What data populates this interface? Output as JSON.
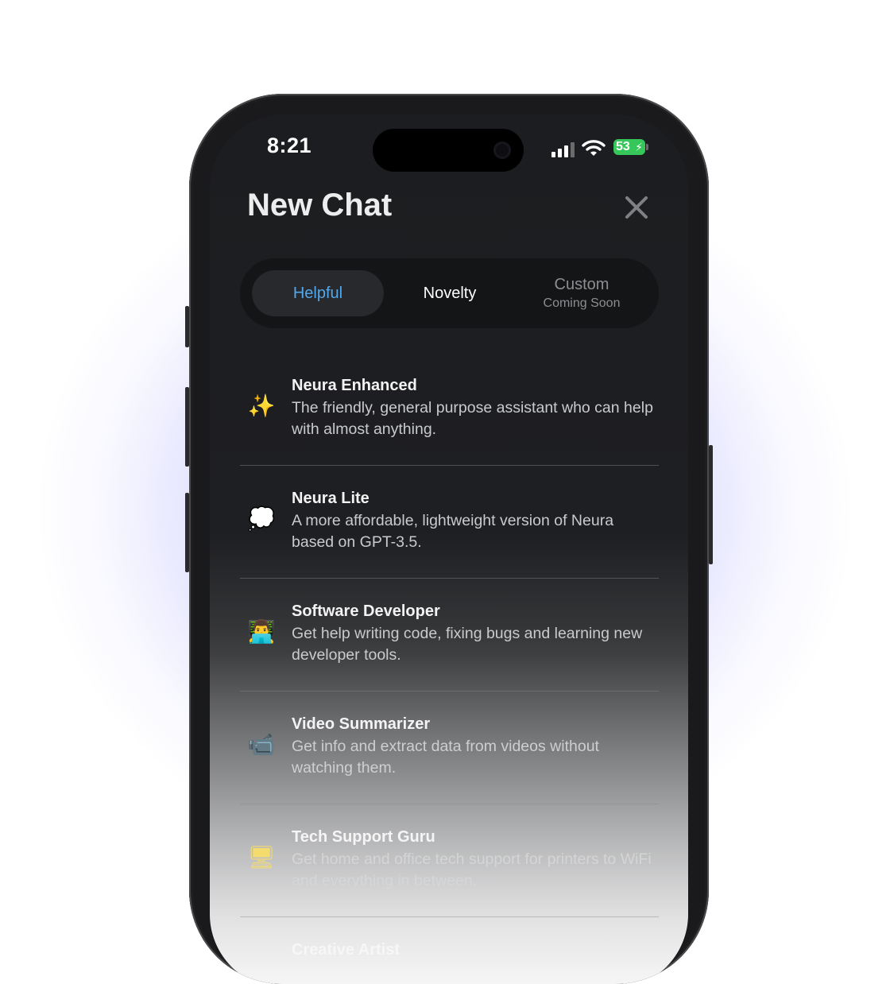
{
  "status_bar": {
    "time": "8:21",
    "battery": "53"
  },
  "header": {
    "title": "New Chat",
    "close_icon": "close-icon"
  },
  "tabs": [
    {
      "label": "Helpful",
      "active": true
    },
    {
      "label": "Novelty",
      "active": false
    },
    {
      "label": "Custom",
      "sublabel": "Coming Soon",
      "active": false
    }
  ],
  "assistants": [
    {
      "icon": "sparkles-icon",
      "glyph": "✨",
      "name": "Neura Enhanced",
      "description": "The friendly, general purpose assistant who can help with almost anything."
    },
    {
      "icon": "thought-bubble-icon",
      "glyph": "💭",
      "name": "Neura Lite",
      "description": "A more affordable, lightweight version of Neura based on GPT-3.5."
    },
    {
      "icon": "technologist-icon",
      "glyph": "👨‍💻",
      "name": "Software Developer",
      "description": "Get help writing code, fixing bugs and learning new developer tools."
    },
    {
      "icon": "video-camera-icon",
      "glyph": "📹",
      "name": "Video Summarizer",
      "description": "Get info and extract data from videos without watching them."
    },
    {
      "icon": "computer-icon",
      "glyph": "🖥",
      "name": "Tech Support Guru",
      "description": "Get home and office tech support for printers to WiFi and everything in between."
    },
    {
      "icon": "palette-icon",
      "glyph": "",
      "name": "Creative Artist",
      "description": ""
    }
  ],
  "colors": {
    "accent": "#52a8ec",
    "battery": "#35c759",
    "glow": "#6e6eff"
  }
}
